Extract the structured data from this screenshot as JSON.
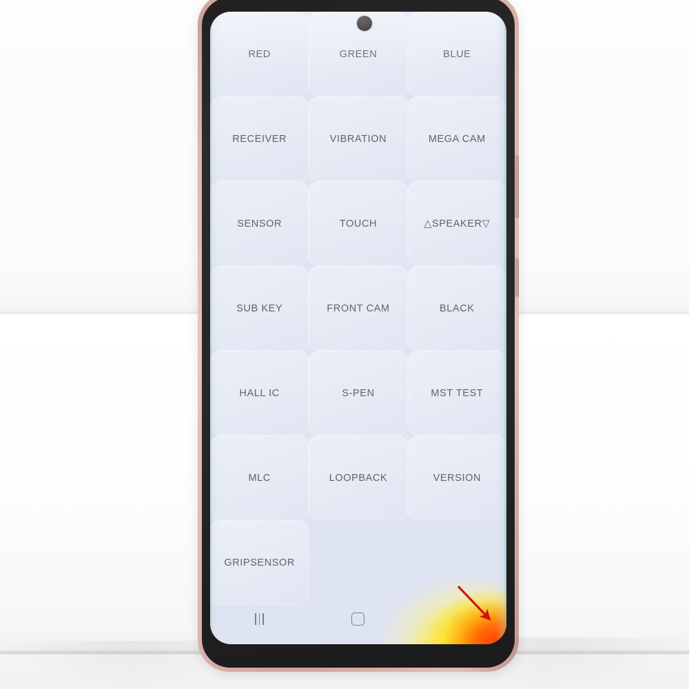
{
  "scene": {
    "subject": "smartphone-service-mode-screen",
    "device_frame_color": "#d4a79e",
    "bezel_color": "#242223",
    "background_color": "#ffffff"
  },
  "screen": {
    "background_color": "#dfe4f2",
    "label_color": "#5e626d",
    "punch_hole_camera": "front-camera-punch-hole"
  },
  "test_grid": {
    "columns": 3,
    "rows": [
      [
        {
          "label": "RED"
        },
        {
          "label": "GREEN"
        },
        {
          "label": "BLUE"
        }
      ],
      [
        {
          "label": "RECEIVER"
        },
        {
          "label": "VIBRATION"
        },
        {
          "label": "MEGA CAM"
        }
      ],
      [
        {
          "label": "SENSOR"
        },
        {
          "label": "TOUCH"
        },
        {
          "label": "△SPEAKER▽"
        }
      ],
      [
        {
          "label": "SUB KEY"
        },
        {
          "label": "FRONT CAM"
        },
        {
          "label": "BLACK"
        }
      ],
      [
        {
          "label": "HALL IC"
        },
        {
          "label": "S-PEN"
        },
        {
          "label": "MST TEST"
        }
      ],
      [
        {
          "label": "MLC"
        },
        {
          "label": "LOOPBACK"
        },
        {
          "label": "VERSION"
        }
      ],
      [
        {
          "label": "GRIPSENSOR"
        },
        {
          "label": "",
          "empty": true
        },
        {
          "label": "",
          "empty": true
        }
      ]
    ]
  },
  "nav_bar": {
    "recents": "recents-icon",
    "home": "home-icon",
    "back": "back-icon"
  },
  "hardware": {
    "volume_button": "volume-rocker",
    "power_button": "power-button"
  },
  "annotation": {
    "arrow_color": "#cc1111",
    "points_at": "display-defect-bottom-right-corner",
    "defect_colors": [
      "#ffe119",
      "#ff9600",
      "#ff3c00"
    ]
  }
}
